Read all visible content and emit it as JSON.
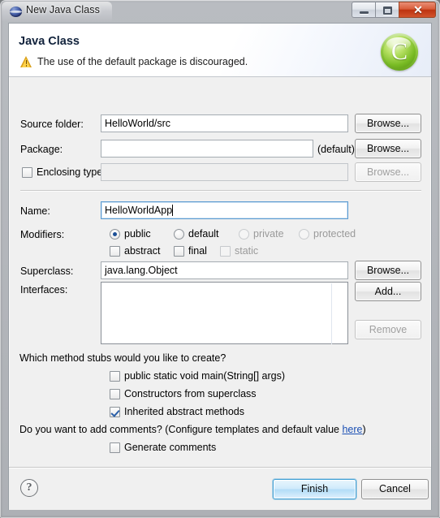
{
  "window": {
    "title": "New Java Class",
    "icon": "java-sphere-icon",
    "buttons": {
      "minimize": "minimize-icon",
      "maximize": "maximize-icon",
      "close": "✕"
    }
  },
  "header": {
    "title": "Java Class",
    "message": "The use of the default package is discouraged.",
    "message_icon": "warning-icon",
    "badge_letter": "C",
    "badge_icon": "java-class-badge-icon",
    "accent_color": "#8fc83f"
  },
  "form": {
    "source_folder": {
      "label": "Source folder:",
      "value": "HelloWorld/src",
      "button": "Browse...",
      "enabled": true
    },
    "package": {
      "label": "Package:",
      "value": "",
      "suffix": "(default)",
      "button": "Browse...",
      "enabled": true
    },
    "enclosing_type": {
      "label": "Enclosing type:",
      "checked": false,
      "value": "",
      "button": "Browse...",
      "enabled": false
    },
    "name": {
      "label": "Name:",
      "value": "HelloWorldApp",
      "focused": true
    },
    "modifiers": {
      "label": "Modifiers:",
      "radios": [
        {
          "label": "public",
          "selected": true,
          "enabled": true
        },
        {
          "label": "default",
          "selected": false,
          "enabled": true
        },
        {
          "label": "private",
          "selected": false,
          "enabled": false
        },
        {
          "label": "protected",
          "selected": false,
          "enabled": false
        }
      ],
      "checkboxes": [
        {
          "label": "abstract",
          "checked": false,
          "enabled": true
        },
        {
          "label": "final",
          "checked": false,
          "enabled": true
        },
        {
          "label": "static",
          "checked": false,
          "enabled": false
        }
      ]
    },
    "superclass": {
      "label": "Superclass:",
      "value": "java.lang.Object",
      "button": "Browse..."
    },
    "interfaces": {
      "label": "Interfaces:",
      "items": [],
      "add_button": "Add...",
      "remove_button": "Remove",
      "remove_enabled": false
    }
  },
  "stubs": {
    "question": "Which method stubs would you like to create?",
    "options": [
      {
        "label": "public static void main(String[] args)",
        "checked": false
      },
      {
        "label": "Constructors from superclass",
        "checked": false
      },
      {
        "label": "Inherited abstract methods",
        "checked": true
      }
    ]
  },
  "comments": {
    "question_prefix": "Do you want to add comments? (Configure templates and default value ",
    "link": "here",
    "question_suffix": ")",
    "option": {
      "label": "Generate comments",
      "checked": false
    }
  },
  "footer": {
    "help_icon": "?",
    "finish": "Finish",
    "cancel": "Cancel",
    "default_button": "Finish"
  }
}
